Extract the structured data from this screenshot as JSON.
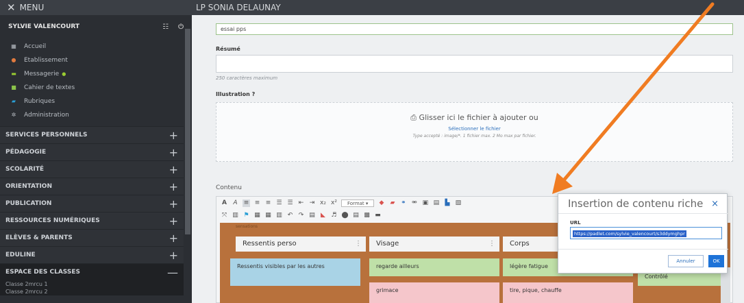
{
  "sidebar": {
    "menu_label": "MENU",
    "user_name": "SYLVIE VALENCOURT",
    "items": [
      {
        "label": "Accueil",
        "icon": "grid-icon",
        "color": "#b9bec4"
      },
      {
        "label": "Etablissement",
        "icon": "school-icon",
        "color": "#e07a3f"
      },
      {
        "label": "Messagerie",
        "icon": "mail-icon",
        "color": "#9acd32"
      },
      {
        "label": "Cahier de textes",
        "icon": "notebook-icon",
        "color": "#8bc34a"
      },
      {
        "label": "Rubriques",
        "icon": "flag-icon",
        "color": "#2a9fd6"
      },
      {
        "label": "Administration",
        "icon": "gear-icon",
        "color": "#b9bec4"
      }
    ],
    "sections": [
      {
        "label": "SERVICES PERSONNELS",
        "toggle": "+"
      },
      {
        "label": "PÉDAGOGIE",
        "toggle": "+"
      },
      {
        "label": "SCOLARITÉ",
        "toggle": "+"
      },
      {
        "label": "ORIENTATION",
        "toggle": "+"
      },
      {
        "label": "PUBLICATION",
        "toggle": "+"
      },
      {
        "label": "RESSOURCES NUMÉRIQUES",
        "toggle": "+"
      },
      {
        "label": "ELÈVES & PARENTS",
        "toggle": "+"
      },
      {
        "label": "EDULINE",
        "toggle": "+"
      },
      {
        "label": "ESPACE DES CLASSES",
        "toggle": "—"
      }
    ],
    "classes": [
      "Classe 2mrcu 1",
      "Classe 2mrcu 2"
    ]
  },
  "header": {
    "title": "LP SONIA DELAUNAY"
  },
  "form": {
    "title_value": "essai pps",
    "resume_label": "Résumé",
    "resume_hint": "250 caractères maximum",
    "illustration_label": "Illustration ?",
    "drop_main": "Glisser ici le fichier à ajouter ou",
    "drop_link": "Sélectionner le fichier",
    "drop_hint": "Type accepté : image/*. 1 fichier max. 2 Mo max par fichier.",
    "contenu_label": "Contenu",
    "format_label": "Format"
  },
  "board": {
    "caption": "sensations",
    "columns": [
      "Ressentis perso",
      "Visage",
      "Corps"
    ],
    "cards": [
      "Ressentis visibles par les autres",
      "regarde ailleurs",
      "légère fatigue",
      "grimace",
      "tire, pique, chauffe",
      "Contrôlé"
    ],
    "colors": {
      "blue": "#a9d3e6",
      "green": "#bfe0a8",
      "pink": "#f5c6cb"
    }
  },
  "modal": {
    "title": "Insertion de contenu riche",
    "close": "×",
    "url_label": "URL",
    "url_value": "https://padlet.com/sylvie_valencourt/s3ddymghpr",
    "cancel": "Annuler",
    "ok": "OK"
  },
  "colors": {
    "accent": "#1e73d8",
    "arrow": "#f07c22",
    "sidebar": "#2b2e33"
  }
}
